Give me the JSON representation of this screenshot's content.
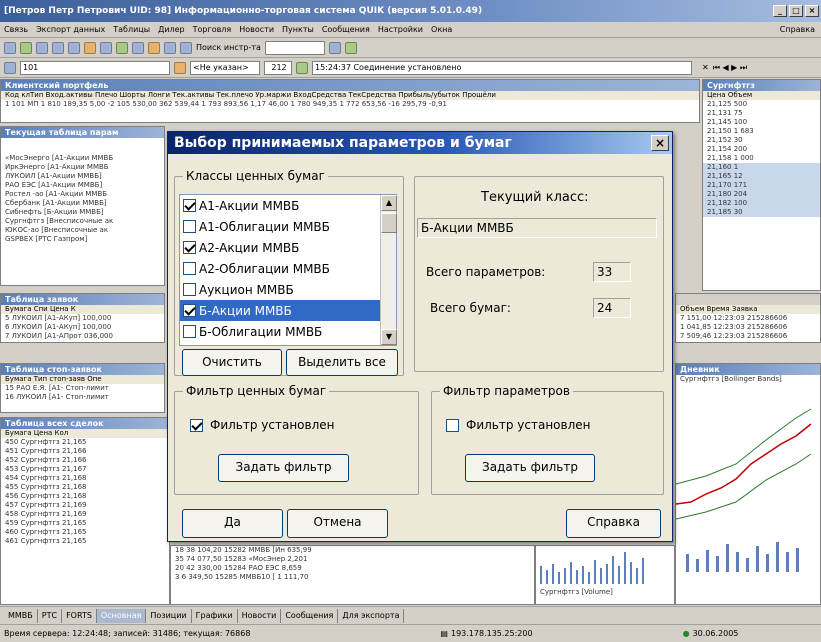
{
  "app": {
    "title": "[Петров Петр Петрович UID: 98] Информационно-торговая система QUIK (версия 5.01.0.49)",
    "menu": [
      "Связь",
      "Экспорт данных",
      "Таблицы",
      "Дилер",
      "Торговля",
      "Новости",
      "Пункты",
      "Сообщения",
      "Настройки",
      "Окна"
    ],
    "menu_right": "Справка",
    "search_label": "Поиск инстр-та",
    "account": "101",
    "not_specified": "<Не указан>",
    "counter": "212",
    "connection_status": "15:24:37 Соединение установлено"
  },
  "background_panels": {
    "portfolio_title": "Клиентский портфель",
    "portfolio_header": "Код клТип  Вход.активы  Плечо    Шорты      Лонги   Тек.активы  Тек.плечо  Ур.маржи  ВходСредства  ТекСредства  Прибыль/убыток  Прошёли",
    "portfolio_row": "1  101   МП  1 810 189,35  5,00 -2 105 530,00 362 539,44 1 793 893,56   1,17     46,00   1 780 949,35  1 772 653,56    -16 295,79     -0,91",
    "current_table_title": "Текущая таблица парам",
    "current_rows": [
      "«МосЭнерго [А1-Акции ММВБ",
      "ИркЭнерго [А1-Акции ММВБ",
      "ЛУКОЙЛ [А1-Акции ММВБ]",
      "РАО ЕЭС [А1-Акции ММВБ]",
      "Ростел -ао [А1-Акции ММВБ",
      "Сбербанк [А1-Акции ММВБ]",
      "Сибнефть [Б-Акции ММВБ]",
      "Сургнфтгз [Внесписочные ак",
      "ЮКОС-ао [Внесписочные ак",
      "GSPBEX [РТС Газпром]"
    ],
    "right_title": "Сургнфтгз",
    "right_header": "Цена     Объем",
    "right_rows": [
      "21,125  500",
      "21,131  75",
      "21,145  100",
      "21,150  1 683",
      "21,152  30",
      "21,154  200",
      "21,158  1 000",
      "21,160  1",
      "21,165  12",
      "21,170  171",
      "21,180  204",
      "21,182  100",
      "21,185  30"
    ],
    "orders_title": "Таблица заявок",
    "orders_rows": [
      "Бумага   Спи  Цена  К",
      "5  ЛУКОЙЛ [А1-АКуп] 100,000",
      "6  ЛУКОЙЛ [А1-АКуп] 100,000",
      "7  ЛУКОЙЛ [А1-АПрот 036,000"
    ],
    "orders_right": [
      "Объем   Время   Заявка",
      "7 151,00  12:23:03  215286606",
      "1 041,85  12:23:03  215286606",
      "7 509,46  12:23:03  215286606"
    ],
    "stop_title": "Таблица стоп-заявок",
    "stop_rows": [
      "Бумага   Тип стоп-заяв Опе",
      "15  РАО Е.Я. [А1-  Стоп-лимит",
      "16  ЛУКОЙЛ [А1-  Стоп-лимит"
    ],
    "chart_title": "Дневник",
    "chart_sub": "Сургнфтгз [Bollinger Bands]",
    "all_trades_title": "Таблица всех сделок",
    "all_trades_rows": [
      "Бумага   Цена   Кол",
      "450  Сургнфтгз  21,165",
      "451  Сургнфтгз  21,166",
      "452  Сургнфтгз  21,166",
      "453  Сургнфтгз  21,167",
      "454  Сургнфтгз  21,168",
      "455  Сургнфтгз  21,168",
      "456  Сургнфтгз  21,168",
      "457  Сургнфтгз  21,169",
      "458  Сургнфтгз  21,169",
      "459  Сургнфтгз  21,165",
      "460  Сургнфтгз  21,165",
      "461  Сургнфтгз  21,165"
    ],
    "bottom_mid_rows": [
      "18  38 104,20  15282 ММВБ [Ин  635,99",
      "35  74 077,50  15283 «МосЭнер  2,201",
      "20  42 330,00  15284 РАО ЕЭС  8,659",
      "3   6 349,50  15285 ММВБ10 [  1 111,70"
    ],
    "chart_legend": "Сургнфтгз [Volume]"
  },
  "tabs": [
    "ММВБ",
    "РТС",
    "FORTS",
    "Основная",
    "Позиции",
    "Графики",
    "Новости",
    "Сообщения",
    "Для экспорта"
  ],
  "active_tab": "Основная",
  "status": {
    "server_time": "Время сервера: 12:24:48; записей: 31486; текущая: 76868",
    "ip": "193.178.135.25:200",
    "date": "30.06.2005"
  },
  "dialog": {
    "title": "Выбор принимаемых параметров и бумаг",
    "classes_group": "Классы ценных бумаг",
    "classes": [
      {
        "label": "А1-Акции ММВБ",
        "checked": true,
        "selected": false
      },
      {
        "label": "А1-Облигации ММВБ",
        "checked": false,
        "selected": false
      },
      {
        "label": "А2-Акции ММВБ",
        "checked": true,
        "selected": false
      },
      {
        "label": "А2-Облигации ММВБ",
        "checked": false,
        "selected": false
      },
      {
        "label": "Аукцион ММВБ",
        "checked": false,
        "selected": false
      },
      {
        "label": "Б-Акции ММВБ",
        "checked": true,
        "selected": true
      },
      {
        "label": "Б-Облигации ММВБ",
        "checked": false,
        "selected": false
      }
    ],
    "clear_button": "Очистить",
    "select_all_button": "Выделить все",
    "current_class_label": "Текущий класс:",
    "current_class_value": "Б-Акции ММВБ",
    "total_params_label": "Всего параметров:",
    "total_params_value": "33",
    "total_securities_label": "Всего бумаг:",
    "total_securities_value": "24",
    "sec_filter_group": "Фильтр ценных бумаг",
    "sec_filter_checkbox": "Фильтр установлен",
    "sec_filter_checked": true,
    "sec_filter_button": "Задать фильтр",
    "param_filter_group": "Фильтр параметров",
    "param_filter_checkbox": "Фильтр установлен",
    "param_filter_checked": false,
    "param_filter_button": "Задать фильтр",
    "ok_button": "Да",
    "cancel_button": "Отмена",
    "help_button": "Справка"
  }
}
